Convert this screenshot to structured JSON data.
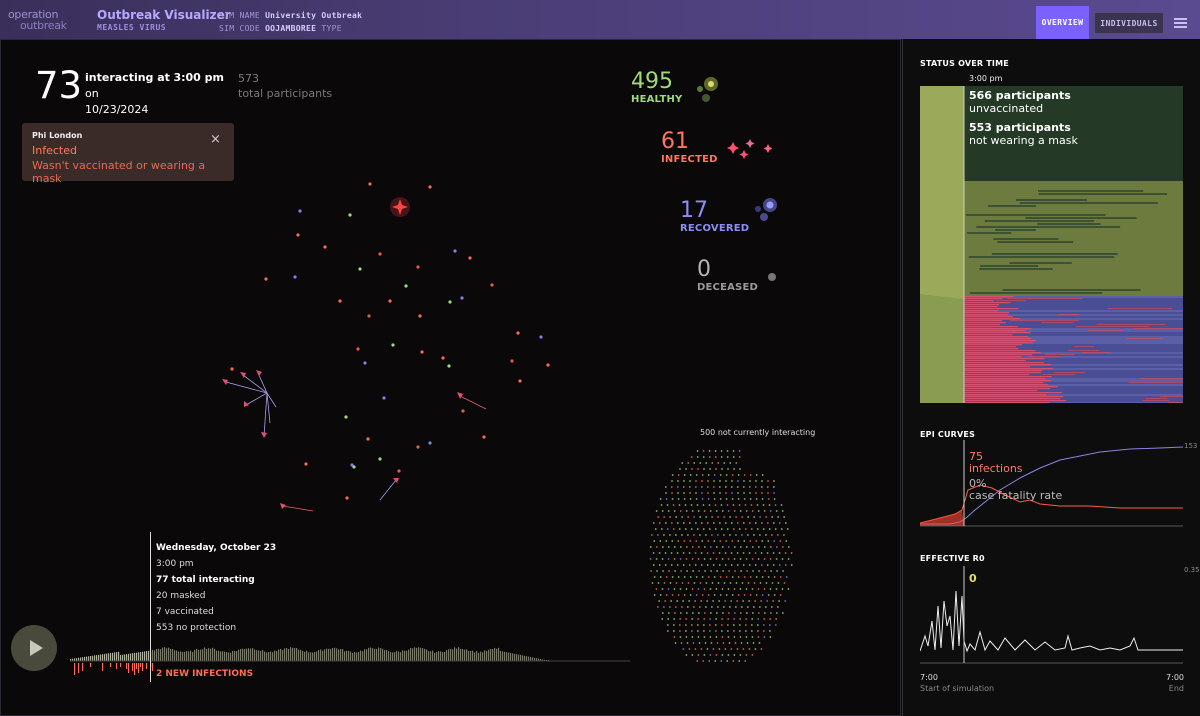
{
  "header": {
    "logo_line1": "operation",
    "logo_line2": "outbreak",
    "title": "Outbreak Visualizer",
    "subtitle": "MEASLES VIRUS",
    "sim_name_label": "SIM NAME",
    "sim_name_value": "University Outbreak",
    "sim_code_label": "SIM CODE",
    "sim_code_value": "OOJAMBOREE",
    "type_label": "TYPE",
    "overview_button": "OVERVIEW",
    "individuals_button": "INDIVIDUALS"
  },
  "summary": {
    "interacting_count": "73",
    "interacting_text": "interacting at",
    "time": "3:00 pm",
    "on_text": "on",
    "date": "10/23/2024",
    "total_participants": "573",
    "total_label": "total participants"
  },
  "tooltip": {
    "name": "Phi London",
    "status": "Infected",
    "reason": "Wasn't vaccinated or wearing a mask",
    "close_glyph": "×"
  },
  "stats": {
    "healthy": {
      "value": "495",
      "label": "HEALTHY",
      "color": "#9fd97a"
    },
    "infected": {
      "value": "61",
      "label": "INFECTED",
      "color": "#ff7560"
    },
    "recovered": {
      "value": "17",
      "label": "RECOVERED",
      "color": "#8d8df5"
    },
    "deceased": {
      "value": "0",
      "label": "DECEASED",
      "color": "#9a9a9a"
    }
  },
  "not_interacting": "500 not currently interacting",
  "timeline_popup": {
    "date": "Wednesday, October 23",
    "time": "3:00 pm",
    "total_interacting": "77 total interacting",
    "masked": "20 masked",
    "vaccinated": "7 vaccinated",
    "no_protection": "553 no protection"
  },
  "new_infections": "2 NEW INFECTIONS",
  "sidebar": {
    "status_title": "STATUS OVER TIME",
    "status_time": "3:00 pm",
    "unvaccinated_count": "566 participants",
    "unvaccinated_label": "unvaccinated",
    "no_mask_count": "553 participants",
    "no_mask_label": "not wearing a mask",
    "epi_title": "EPI CURVES",
    "epi_max": "153",
    "infections_value": "75",
    "infections_label": "infections",
    "fatality_value": "0%",
    "fatality_label": "case fatality rate",
    "r0_title": "EFFECTIVE R0",
    "r0_value": "0",
    "r0_max": "0.35",
    "axis_start_time": "7:00",
    "axis_start_label": "Start of simulation",
    "axis_end_time": "7:00",
    "axis_end_label": "End"
  },
  "colors": {
    "healthy": "#9fd97a",
    "infected": "#ff6a55",
    "recovered": "#8080ee",
    "accent": "#7b62ff",
    "olive": "#8a9a55"
  }
}
